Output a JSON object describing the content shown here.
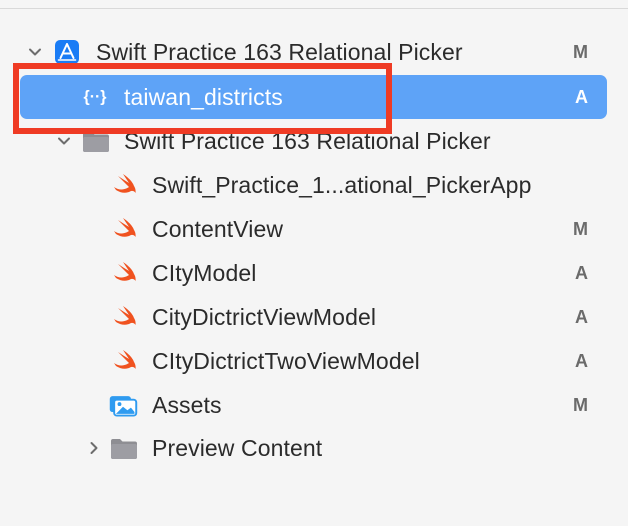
{
  "navigator": {
    "rows": [
      {
        "label": "Swift Practice 163 Relational Picker",
        "status": "M",
        "icon": "xcode-project-icon",
        "disclosure": "chevron-down-icon",
        "selected": false
      },
      {
        "label": "taiwan_districts",
        "status": "A",
        "icon": "json-file-icon",
        "disclosure": "",
        "selected": true
      },
      {
        "label": "Swift Practice 163 Relational Picker",
        "status": "",
        "icon": "folder-icon",
        "disclosure": "chevron-down-icon",
        "selected": false
      },
      {
        "label": "Swift_Practice_1...ational_PickerApp",
        "status": "",
        "icon": "swift-file-icon",
        "disclosure": "",
        "selected": false
      },
      {
        "label": "ContentView",
        "status": "M",
        "icon": "swift-file-icon",
        "disclosure": "",
        "selected": false
      },
      {
        "label": "CItyModel",
        "status": "A",
        "icon": "swift-file-icon",
        "disclosure": "",
        "selected": false
      },
      {
        "label": "CityDictrictViewModel",
        "status": "A",
        "icon": "swift-file-icon",
        "disclosure": "",
        "selected": false
      },
      {
        "label": "CItyDictrictTwoViewModel",
        "status": "A",
        "icon": "swift-file-icon",
        "disclosure": "",
        "selected": false
      },
      {
        "label": "Assets",
        "status": "M",
        "icon": "asset-catalog-icon",
        "disclosure": "",
        "selected": false
      },
      {
        "label": "Preview Content",
        "status": "",
        "icon": "folder-icon",
        "disclosure": "chevron-right-icon",
        "selected": false
      }
    ]
  },
  "colors": {
    "selection": "#5ea3f7",
    "annotation_box": "#ef3b24",
    "swift_orange": "#f0521f",
    "folder_gray": "#8e8e93",
    "xcode_blue": "#1a7cf5"
  }
}
